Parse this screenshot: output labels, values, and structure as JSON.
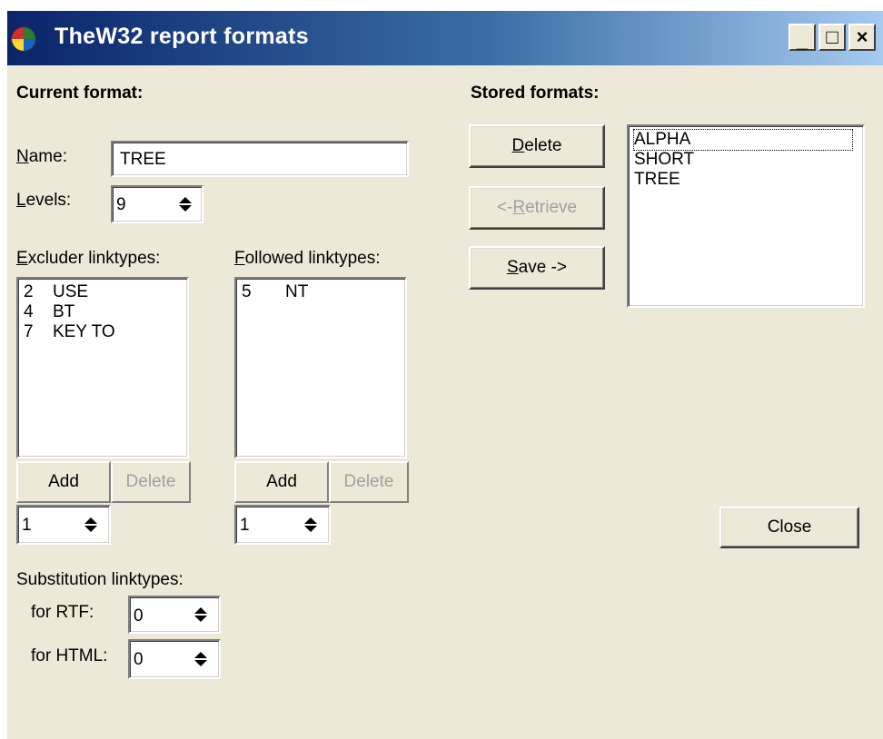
{
  "window": {
    "title": "TheW32 report formats",
    "controls": {
      "minimize": "_",
      "maximize": "□",
      "close": "×"
    }
  },
  "current": {
    "heading": "Current format:",
    "name_label": {
      "accel": "N",
      "rest": "ame:"
    },
    "name_value": "TREE",
    "levels_label": {
      "accel": "L",
      "rest": "evels:"
    },
    "levels_value": "9"
  },
  "excluder": {
    "label": {
      "accel": "E",
      "rest": "xcluder linktypes:"
    },
    "items": [
      {
        "num": "2",
        "name": "USE"
      },
      {
        "num": "4",
        "name": "BT"
      },
      {
        "num": "7",
        "name": "KEY TO"
      }
    ],
    "add_label": "Add",
    "delete_label": "Delete",
    "spin_value": "1"
  },
  "followed": {
    "label": {
      "accel": "F",
      "rest": "ollowed linktypes:"
    },
    "items": [
      {
        "num": "5",
        "name": "NT"
      }
    ],
    "add_label": "Add",
    "delete_label": "Delete",
    "spin_value": "1"
  },
  "substitution": {
    "heading": "Substitution linktypes:",
    "rtf_label": "for RTF:",
    "rtf_value": "0",
    "html_label": "for HTML:",
    "html_value": "0"
  },
  "stored": {
    "heading": "Stored formats:",
    "delete_label": {
      "accel": "D",
      "rest": "elete"
    },
    "retrieve_label": {
      "pre": "<- ",
      "accel": "R",
      "rest": "etrieve"
    },
    "save_label": {
      "accel": "S",
      "rest": "ave ->"
    },
    "items": [
      "ALPHA",
      "SHORT",
      "TREE"
    ]
  },
  "close_label": "Close",
  "colors": {
    "titlebar_start": "#0a246a",
    "titlebar_end": "#a6caf0",
    "face": "#ece9d8"
  }
}
